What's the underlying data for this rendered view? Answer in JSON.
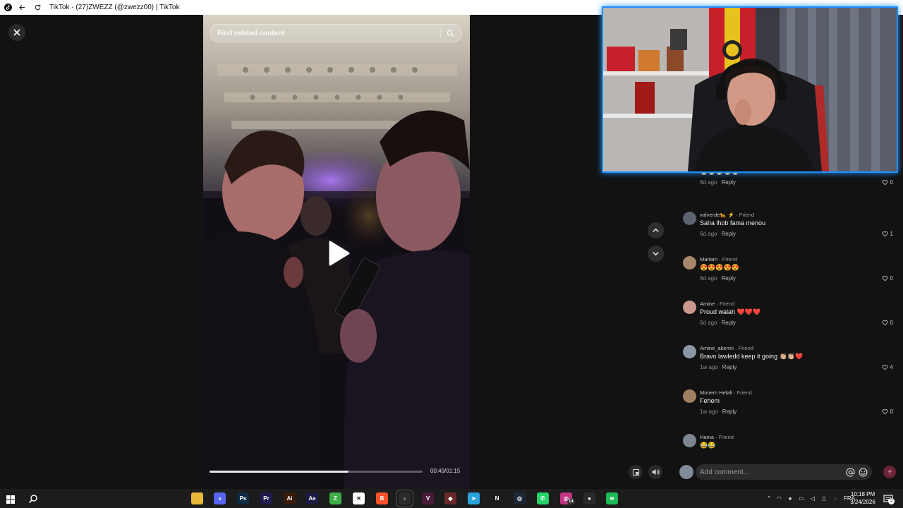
{
  "window": {
    "title": "TikTok - (27)ZWEZZ (@zwezz00) | TikTok"
  },
  "player": {
    "search_placeholder": "Find related content",
    "time": "00:49/01:15",
    "progress": 0.653
  },
  "comments": [
    {
      "author": "",
      "tag": "",
      "text": "🔥🔥🔥🔥🔥",
      "age": "6d ago",
      "reply": "Reply",
      "likes": "0",
      "avatar_color": "#6f7a8a"
    },
    {
      "author": "valverde🐆 ⚡",
      "tag": "Friend",
      "text": "Saha lhob fama menou",
      "age": "6d ago",
      "reply": "Reply",
      "likes": "1",
      "avatar_color": "#5b6470"
    },
    {
      "author": "Mariam",
      "tag": "Friend",
      "text": "😍😍😍😍😍",
      "age": "6d ago",
      "reply": "Reply",
      "likes": "0",
      "avatar_color": "#a8866a"
    },
    {
      "author": "Amine",
      "tag": "Friend",
      "text": "Proud walah ❤️❤️❤️",
      "age": "6d ago",
      "reply": "Reply",
      "likes": "0",
      "avatar_color": "#c99a8c"
    },
    {
      "author": "Amine_akermi",
      "tag": "Friend",
      "text": "Bravo lawledd keep it going 👏🏼👏🏼❤️",
      "age": "1w ago",
      "reply": "Reply",
      "likes": "4",
      "avatar_color": "#8a96a6"
    },
    {
      "author": "Monem Helali",
      "tag": "Friend",
      "text": "Fehem",
      "age": "1w ago",
      "reply": "Reply",
      "likes": "0",
      "avatar_color": "#a08060"
    },
    {
      "author": "Hama",
      "tag": "Friend",
      "text": "😂😂",
      "age": "",
      "reply": "",
      "likes": "",
      "avatar_color": "#7d8590"
    }
  ],
  "composer": {
    "placeholder": "Add comment..."
  },
  "taskbar": {
    "language": "FRA",
    "time": "10:18 PM",
    "date": "3/24/2026",
    "notification_count": "3",
    "instagram_badge": "14",
    "apps": [
      {
        "name": "file-explorer",
        "color": "#e8b83a",
        "glyph": ""
      },
      {
        "name": "discord",
        "color": "#5865f2",
        "glyph": "◕"
      },
      {
        "name": "photoshop",
        "color": "#0f2a45",
        "glyph": "Ps"
      },
      {
        "name": "premiere",
        "color": "#1e1a4a",
        "glyph": "Pr"
      },
      {
        "name": "illustrator",
        "color": "#3a1c08",
        "glyph": "Ai"
      },
      {
        "name": "after-effects",
        "color": "#1a1a44",
        "glyph": "Ae"
      },
      {
        "name": "app-green",
        "color": "#3fae49",
        "glyph": "Z"
      },
      {
        "name": "capcut",
        "color": "#ffffff",
        "glyph": "✕"
      },
      {
        "name": "brave",
        "color": "#fb542b",
        "glyph": "B"
      },
      {
        "name": "tiktok",
        "color": "#2b2b2b",
        "glyph": "♪"
      },
      {
        "name": "vegas",
        "color": "#4a1a3a",
        "glyph": "V"
      },
      {
        "name": "game",
        "color": "#6a2a2a",
        "glyph": "◆"
      },
      {
        "name": "telegram",
        "color": "#2aa3dd",
        "glyph": "➤"
      },
      {
        "name": "netflix",
        "color": "#1c1c1c",
        "glyph": "N"
      },
      {
        "name": "steam",
        "color": "#1b2838",
        "glyph": "◎"
      },
      {
        "name": "whatsapp",
        "color": "#25d366",
        "glyph": "✆"
      },
      {
        "name": "instagram",
        "color": "#c13584",
        "glyph": "◎"
      },
      {
        "name": "obs",
        "color": "#2a2a2a",
        "glyph": "●"
      },
      {
        "name": "spotify",
        "color": "#1db954",
        "glyph": "≋"
      }
    ]
  }
}
